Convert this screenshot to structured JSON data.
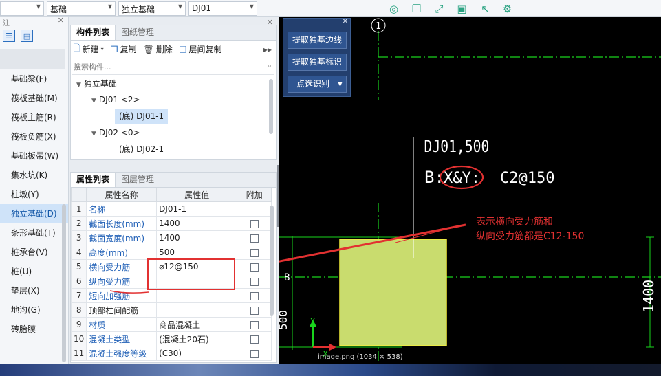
{
  "topbar": {
    "combo1": "",
    "combo2": "基础",
    "combo3": "独立基础",
    "combo4": "DJ01"
  },
  "leftnav": {
    "header": "注",
    "items": [
      {
        "label": "基础梁(F)"
      },
      {
        "label": "筏板基础(M)"
      },
      {
        "label": "筏板主筋(R)"
      },
      {
        "label": "筏板负筋(X)"
      },
      {
        "label": "基础板带(W)"
      },
      {
        "label": "集水坑(K)"
      },
      {
        "label": "柱墩(Y)"
      },
      {
        "label": "独立基础(D)",
        "selected": true
      },
      {
        "label": "条形基础(T)"
      },
      {
        "label": "桩承台(V)"
      },
      {
        "label": "桩(U)"
      },
      {
        "label": "垫层(X)"
      },
      {
        "label": "地沟(G)"
      },
      {
        "label": "砖胎膜"
      }
    ]
  },
  "component_panel": {
    "tabs": [
      "构件列表",
      "图纸管理"
    ],
    "toolbar": {
      "new": "新建",
      "copy": "复制",
      "delete": "删除",
      "floor_copy": "层间复制"
    },
    "search_placeholder": "搜索构件...",
    "tree": {
      "root": "独立基础",
      "dj01": "DJ01 <2>",
      "dj01_child": "(底) DJ01-1",
      "dj02": "DJ02 <0>",
      "dj02_child": "(底) DJ02-1"
    }
  },
  "property_panel": {
    "tabs": [
      "属性列表",
      "图层管理"
    ],
    "columns": [
      "属性名称",
      "属性值",
      "附加"
    ],
    "rows": [
      {
        "num": "1",
        "name": "名称",
        "value": "DJ01-1",
        "blue": true
      },
      {
        "num": "2",
        "name": "截面长度(mm)",
        "value": "1400",
        "blue": true
      },
      {
        "num": "3",
        "name": "截面宽度(mm)",
        "value": "1400",
        "blue": true
      },
      {
        "num": "4",
        "name": "高度(mm)",
        "value": "500",
        "blue": true
      },
      {
        "num": "5",
        "name": "横向受力筋",
        "value": "⌀12@150",
        "blue": true
      },
      {
        "num": "6",
        "name": "纵向受力筋",
        "value": "",
        "blue": true
      },
      {
        "num": "7",
        "name": "短向加强筋",
        "value": "",
        "blue": true
      },
      {
        "num": "8",
        "name": "顶部柱间配筋",
        "value": "",
        "blue": false
      },
      {
        "num": "9",
        "name": "材质",
        "value": "商品混凝土",
        "blue": true
      },
      {
        "num": "10",
        "name": "混凝土类型",
        "value": "(混凝土20石)",
        "blue": true
      },
      {
        "num": "11",
        "name": "混凝土强度等级",
        "value": "(C30)",
        "blue": true
      }
    ]
  },
  "recognition_panel": {
    "btn_edge": "提取独基边线",
    "btn_label": "提取独基标识",
    "btn_point": "点选识别"
  },
  "drawing": {
    "axis_number": "1",
    "text_line1": "DJ01,500",
    "text_line2_prefix": "B:",
    "text_line2_xy": "X&Y:",
    "text_line2_bar": "C2@150",
    "annotation_line1": "表示横向受力筋和",
    "annotation_line2": "纵向受力筋都是C12-150",
    "dim_label_b": "B",
    "dim_value_right": "1400",
    "dim_value_left": "500",
    "ucs_y": "Y",
    "ucs_x": "X"
  },
  "caption": "image.png (1034 × 538)",
  "colors": {
    "canvas_bg": "#000000",
    "footing_fill": "#c9dc6e",
    "footing_border": "#f5ef3a",
    "drawing_text": "#ffffff",
    "markup_red": "#e23131",
    "grid_green": "#19d41d",
    "accent_blue": "#1f5fb6"
  }
}
